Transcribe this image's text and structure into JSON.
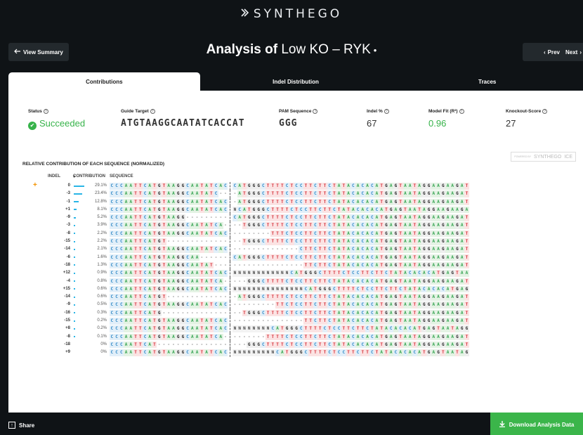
{
  "header": {
    "logo_text": "SYNTHEGO",
    "logo_icon": "synthego-chevron-icon",
    "title_prefix": "Analysis of",
    "sample_name": "Low KO – RYK",
    "dropdown_icon": "chevron-down-icon",
    "view_summary_label": "View Summary",
    "prev_label": "Prev",
    "next_label": "Next"
  },
  "tabs": [
    {
      "label": "Contributions",
      "active": true
    },
    {
      "label": "Indel Distribution",
      "active": false
    },
    {
      "label": "Traces",
      "active": false
    }
  ],
  "stats": {
    "status": {
      "label": "Status",
      "value": "Succeeded"
    },
    "guide_target": {
      "label": "Guide Target",
      "value": "ATGTAAGGCAATATCACCAT"
    },
    "pam_sequence": {
      "label": "PAM Sequence",
      "value": "GGG"
    },
    "indel_percent": {
      "label": "Indel %",
      "value": "67"
    },
    "model_fit": {
      "label": "Model Fit (R²)",
      "value": "0.96"
    },
    "knockout_score": {
      "label": "Knockout-Score",
      "value": "27"
    }
  },
  "contributions": {
    "section_title": "RELATIVE CONTRIBUTION OF EACH SEQUENCE (NORMALIZED)",
    "powered_by": "POWERED BY",
    "powered_brand": "SYNTHEGO",
    "powered_tool": "ICE",
    "columns": {
      "indel": "INDEL",
      "contribution": "CONTRIBUTION",
      "sequence": "SEQUENCE"
    },
    "sort_icon": "sort-desc-icon",
    "rows": [
      {
        "indel": "0",
        "pct": "29.1%",
        "value": 29.1,
        "left": "CCCAATTCATGTAAGGCAATATCAC",
        "right": "CATGGGCTTTTCTCCTTCTTCTATACACACATGAGTAATAGGAAGAAGAT"
      },
      {
        "indel": "-3",
        "pct": "23.4%",
        "value": 23.4,
        "left": "CCCAATTCATGTAAGGCAATATC--",
        "right": "-ATGGGCTTTTCTCCTTCTTCTATACACACATGAGTAATAGGAAGAAGAT"
      },
      {
        "indel": "-1",
        "pct": "12.8%",
        "value": 12.8,
        "left": "CCCAATTCATGTAAGGCAATATCAC",
        "right": "-ATGGGCTTTTCTCCTTCTTCTATACACACATGAGTAATAGGAAGAAGAT"
      },
      {
        "indel": "+1",
        "pct": "8.1%",
        "value": 8.1,
        "left": "CCCAATTCATGTAAGGCAATATCAC",
        "right": "NCATGGGCTTTTCTCCTTCTTCTATACACACATGAGTAATAGGAAGAAGA"
      },
      {
        "indel": "-9",
        "pct": "5.2%",
        "value": 5.2,
        "left": "CCCAATTCATGTAAGG---------",
        "right": "CATGGGCTTTTCTCCTTCTTCTATACACACATGAGTAATAGGAAGAAGAT"
      },
      {
        "indel": "-3",
        "pct": "3.9%",
        "value": 3.9,
        "left": "CCCAATTCATGTAAGGCAATATCA-",
        "right": "--TGGGCTTTTCTCCTTCTTCTATACACACATGAGTAATAGGAAGAAGAT"
      },
      {
        "indel": "-8",
        "pct": "2.2%",
        "value": 2.2,
        "left": "CCCAATTCATGTAAGGCAATATCAC",
        "right": "--------TTTCTCCTTCTTCTATACACACATGAGTAATAGGAAGAAGAT"
      },
      {
        "indel": "-15",
        "pct": "2.2%",
        "value": 2.2,
        "left": "CCCAATTCATGT-------------",
        "right": "--TGGGCTTTTCTCCTTCTTCTATACACACATGAGTAATAGGAAGAAGAT"
      },
      {
        "indel": "-14",
        "pct": "2.1%",
        "value": 2.1,
        "left": "CCCAATTCATGTAAGGCAATATCAC",
        "right": "--------------CTTCTTCTATACACACATGAGTAATAGGAAGAAGAT"
      },
      {
        "indel": "-6",
        "pct": "1.6%",
        "value": 1.6,
        "left": "CCCAATTCATGTAAGGCAA------",
        "right": "CATGGGCTTTTCTCCTTCTTCTATACACACATGAGTAATAGGAAGAAGAT"
      },
      {
        "indel": "-18",
        "pct": "1.3%",
        "value": 1.3,
        "left": "CCCAATTCATGTAAGGCAATAT---",
        "right": "---------------TTCTTCTATACACACATGAGTAATAGGAAGAAGAT"
      },
      {
        "indel": "+12",
        "pct": "0.9%",
        "value": 0.9,
        "left": "CCCAATTCATGTAAGGCAATATCAC",
        "right": "NNNNNNNNNNNNCATGGGCTTTTCTCCTTCTTCTATACACACATGAGTAA"
      },
      {
        "indel": "-4",
        "pct": "0.8%",
        "value": 0.8,
        "left": "CCCAATTCATGTAAGGCAATATCA-",
        "right": "---GGGCTTTTCTCCTTCTTCTATACACACATGAGTAATAGGAAGAAGAT"
      },
      {
        "indel": "+15",
        "pct": "0.6%",
        "value": 0.6,
        "left": "CCCAATTCATGTAAGGCAATATCAC",
        "right": "NNNNNNNNNNNNNNNCATGGGCTTTTCTCCTTCTTCTATACACACATGAG"
      },
      {
        "indel": "-14",
        "pct": "0.6%",
        "value": 0.6,
        "left": "CCCAATTCATGT-------------",
        "right": "-ATGGGCTTTTCTCCTTCTTCTATACACACATGAGTAATAGGAAGAAGAT"
      },
      {
        "indel": "-9",
        "pct": "0.5%",
        "value": 0.5,
        "left": "CCCAATTCATGTAAGGCAATATCAC",
        "right": "---------TTCTCCTTCTTCTATACACACATGAGTAATAGGAAGAAGAT"
      },
      {
        "indel": "-16",
        "pct": "0.3%",
        "value": 0.3,
        "left": "CCCAATTCATG--------------",
        "right": "--TGGGCTTTTCTCCTTCTTCTATACACACATGAGTAATAGGAAGAAGAT"
      },
      {
        "indel": "-15",
        "pct": "0.2%",
        "value": 0.2,
        "left": "CCCAATTCATGTAAGGCAATATCAC",
        "right": "---------------TTCTTCTATACACACATGAGTAATAGGAAGAAGAT"
      },
      {
        "indel": "+8",
        "pct": "0.2%",
        "value": 0.2,
        "left": "CCCAATTCATGTAAGGCAATATCAC",
        "right": "NNNNNNNNCATGGGCTTTTCTCCTTCTTCTATACACACATGAGTAATAGG"
      },
      {
        "indel": "-8",
        "pct": "0.1%",
        "value": 0.1,
        "left": "CCCAATTCATGTAAGGCAATATCA-",
        "right": "-------TTTTCTCCTTCTTCTATACACACATGAGTAATAGGAAGAAGAT"
      },
      {
        "indel": "-18",
        "pct": "0%",
        "value": 0,
        "left": "CCCAATTCAT---------------",
        "right": "---GGGCTTTTCTCCTTCTTCTATACACACATGAGTAATAGGAAGAAGAT"
      },
      {
        "indel": "+9",
        "pct": "0%",
        "value": 0,
        "left": "CCCAATTCATGTAAGGCAATATCAC",
        "right": "NNNNNNNNNCATGGGCTTTTCTCCTTCTTCTATACACACATGAGTAATAG"
      }
    ]
  },
  "footer": {
    "share_label": "Share",
    "share_icon": "share-icon",
    "download_label": "Download Analysis Data",
    "download_icon": "download-icon"
  },
  "colors": {
    "brand_green": "#3bb54a",
    "bar_blue": "#29b5e6",
    "reference_marker": "#f39200",
    "background": "#0f1316"
  }
}
